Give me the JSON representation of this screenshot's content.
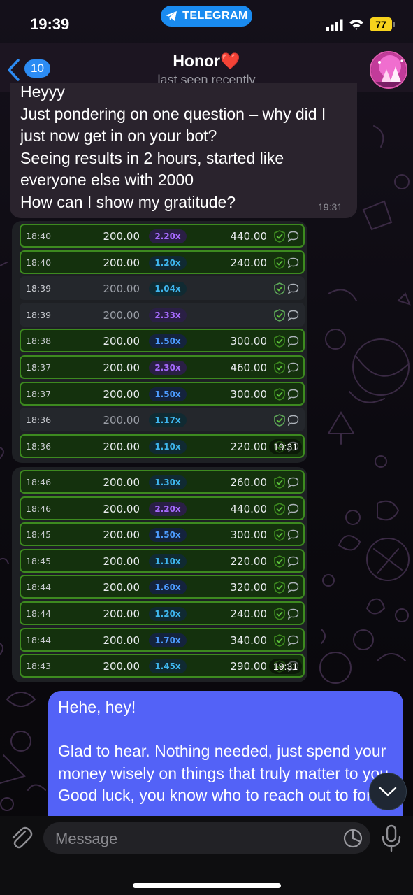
{
  "status_bar": {
    "time": "19:39",
    "app_pill": "TELEGRAM",
    "battery": "77"
  },
  "header": {
    "back_count": "10",
    "contact_name": "Honor❤️",
    "contact_status": "last seen recently"
  },
  "messages": {
    "incoming_text": "Heyyy\nJust pondering on one question – why did I just now get in on your bot?\nSeeing results in 2 hours, started like everyone else with 2000\nHow can I show my gratitude?",
    "incoming_time": "19:31",
    "image1_time": "19:31",
    "image2_time": "19:31",
    "outgoing_text": "Hehe, hey!\n\nGlad to hear. Nothing needed, just spend your money wisely on things that truly matter to you.\nGood luck, you know who to reach out to for"
  },
  "bets_image1": [
    {
      "time": "18:40",
      "amount": "200.00",
      "mult": "2.20x",
      "payout": "440.00",
      "status": "won"
    },
    {
      "time": "18:40",
      "amount": "200.00",
      "mult": "1.20x",
      "payout": "240.00",
      "status": "won"
    },
    {
      "time": "18:39",
      "amount": "200.00",
      "mult": "1.04x",
      "payout": "",
      "status": "lost"
    },
    {
      "time": "18:39",
      "amount": "200.00",
      "mult": "2.33x",
      "payout": "",
      "status": "lost"
    },
    {
      "time": "18:38",
      "amount": "200.00",
      "mult": "1.50x",
      "payout": "300.00",
      "status": "won"
    },
    {
      "time": "18:37",
      "amount": "200.00",
      "mult": "2.30x",
      "payout": "460.00",
      "status": "won"
    },
    {
      "time": "18:37",
      "amount": "200.00",
      "mult": "1.50x",
      "payout": "300.00",
      "status": "won"
    },
    {
      "time": "18:36",
      "amount": "200.00",
      "mult": "1.17x",
      "payout": "",
      "status": "lost"
    },
    {
      "time": "18:36",
      "amount": "200.00",
      "mult": "1.10x",
      "payout": "220.00",
      "status": "won"
    }
  ],
  "bets_image2": [
    {
      "time": "18:46",
      "amount": "200.00",
      "mult": "1.30x",
      "payout": "260.00",
      "status": "won"
    },
    {
      "time": "18:46",
      "amount": "200.00",
      "mult": "2.20x",
      "payout": "440.00",
      "status": "won"
    },
    {
      "time": "18:45",
      "amount": "200.00",
      "mult": "1.50x",
      "payout": "300.00",
      "status": "won"
    },
    {
      "time": "18:45",
      "amount": "200.00",
      "mult": "1.10x",
      "payout": "220.00",
      "status": "won"
    },
    {
      "time": "18:44",
      "amount": "200.00",
      "mult": "1.60x",
      "payout": "320.00",
      "status": "won"
    },
    {
      "time": "18:44",
      "amount": "200.00",
      "mult": "1.20x",
      "payout": "240.00",
      "status": "won"
    },
    {
      "time": "18:44",
      "amount": "200.00",
      "mult": "1.70x",
      "payout": "340.00",
      "status": "won"
    },
    {
      "time": "18:43",
      "amount": "200.00",
      "mult": "1.45x",
      "payout": "290.00",
      "status": "won"
    }
  ],
  "input": {
    "placeholder": "Message"
  },
  "colors": {
    "telegram_blue": "#1a8bf0",
    "outgoing_bubble": "#5362f7",
    "incoming_bubble": "#2a232d",
    "won_row_border": "#3d8a1f",
    "battery": "#f7d21c"
  },
  "icons": {
    "back": "chevron-left-icon",
    "pill": "telegram-plane-icon",
    "attach": "paperclip-icon",
    "sticker": "sticker-icon",
    "mic": "microphone-icon",
    "scroll": "chevron-down-icon",
    "verified": "shield-check-icon",
    "comment": "speech-bubble-icon"
  }
}
